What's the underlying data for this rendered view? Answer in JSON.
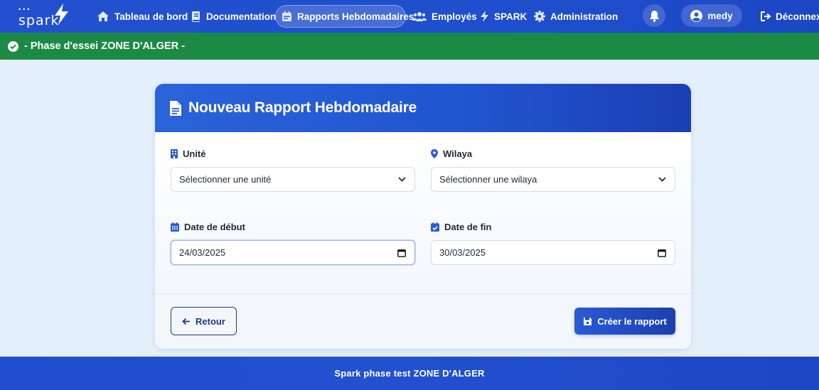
{
  "brand": {
    "name": "spark",
    "accent": "#ffffff"
  },
  "nav": {
    "items": [
      {
        "id": "dashboard",
        "label": "Tableau de bord",
        "icon": "home-icon"
      },
      {
        "id": "docs",
        "label": "Documentation",
        "icon": "book-icon"
      },
      {
        "id": "reports",
        "label": "Rapports Hebdomadaires",
        "icon": "calendar-icon",
        "active": true
      },
      {
        "id": "employees",
        "label": "Employés",
        "icon": "users-icon"
      },
      {
        "id": "spark",
        "label": "SPARK",
        "icon": "bolt-icon"
      },
      {
        "id": "admin",
        "label": "Administration",
        "icon": "gear-icon"
      }
    ],
    "user": "medy",
    "logout": "Déconnexion"
  },
  "phase_banner": {
    "text": "- Phase d'essei ZONE D'ALGER -",
    "color": "#1c8a45"
  },
  "form": {
    "title": "Nouveau Rapport Hebdomadaire",
    "unit": {
      "label": "Unité",
      "placeholder": "Sélectionner une unité"
    },
    "wilaya": {
      "label": "Wilaya",
      "placeholder": "Sélectionner une wilaya"
    },
    "start_date": {
      "label": "Date de début",
      "value": "24/03/2025"
    },
    "end_date": {
      "label": "Date de fin",
      "value": "30/03/2025"
    },
    "back_label": "Retour",
    "submit_label": "Créer le rapport"
  },
  "footer": {
    "text": "Spark phase test ZONE D'ALGER"
  },
  "colors": {
    "primary": "#2350cf",
    "success": "#1c8a45",
    "page_bg": "#e3effb"
  }
}
